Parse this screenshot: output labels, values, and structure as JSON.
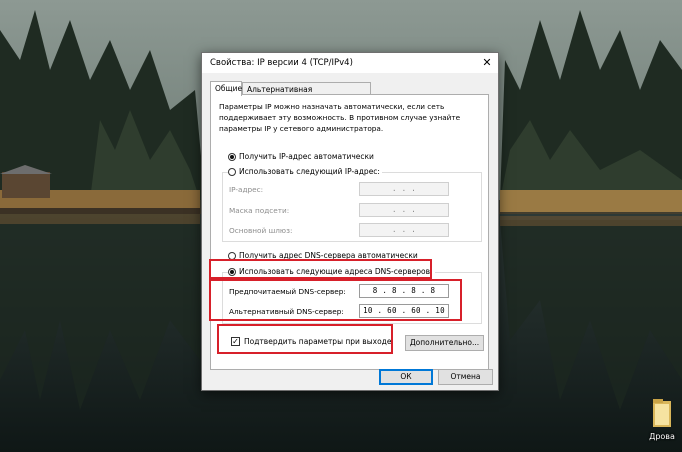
{
  "dialog": {
    "title": "Свойства: IP версии 4 (TCP/IPv4)",
    "close_glyph": "✕",
    "tabs": [
      {
        "label": "Общие",
        "active": true
      },
      {
        "label": "Альтернативная конфигурация",
        "active": false
      }
    ],
    "description": "Параметры IP можно назначать автоматически, если сеть поддерживает эту возможность. В противном случае узнайте параметры IP у сетевого администратора.",
    "ip_section": {
      "auto_label": "Получить IP-адрес автоматически",
      "auto_selected": true,
      "manual_label": "Использовать следующий IP-адрес:",
      "manual_selected": false,
      "fields": [
        {
          "label": "IP-адрес:",
          "value": ". . ."
        },
        {
          "label": "Маска подсети:",
          "value": ". . ."
        },
        {
          "label": "Основной шлюз:",
          "value": ". . ."
        }
      ]
    },
    "dns_section": {
      "auto_label": "Получить адрес DNS-сервера автоматически",
      "auto_selected": false,
      "manual_label": "Использовать следующие адреса DNS-серверов:",
      "manual_selected": true,
      "fields": [
        {
          "label": "Предпочитаемый DNS-сервер:",
          "value": "8 . 8 . 8 . 8"
        },
        {
          "label": "Альтернативный DNS-сервер:",
          "value": "10 . 60 . 60 . 10"
        }
      ]
    },
    "validate_on_exit": {
      "label": "Подтвердить параметры при выходе",
      "checked": true,
      "check_glyph": "✓"
    },
    "advanced_button": "Дополнительно...",
    "ok_button": "ОК",
    "cancel_button": "Отмена"
  },
  "desktop": {
    "icon_label": "Дрова",
    "icon_name": "folder-icon"
  },
  "colors": {
    "highlight": "#d7202a",
    "default_button_border": "#0078d7",
    "dialog_bg": "#f0f0f0"
  }
}
